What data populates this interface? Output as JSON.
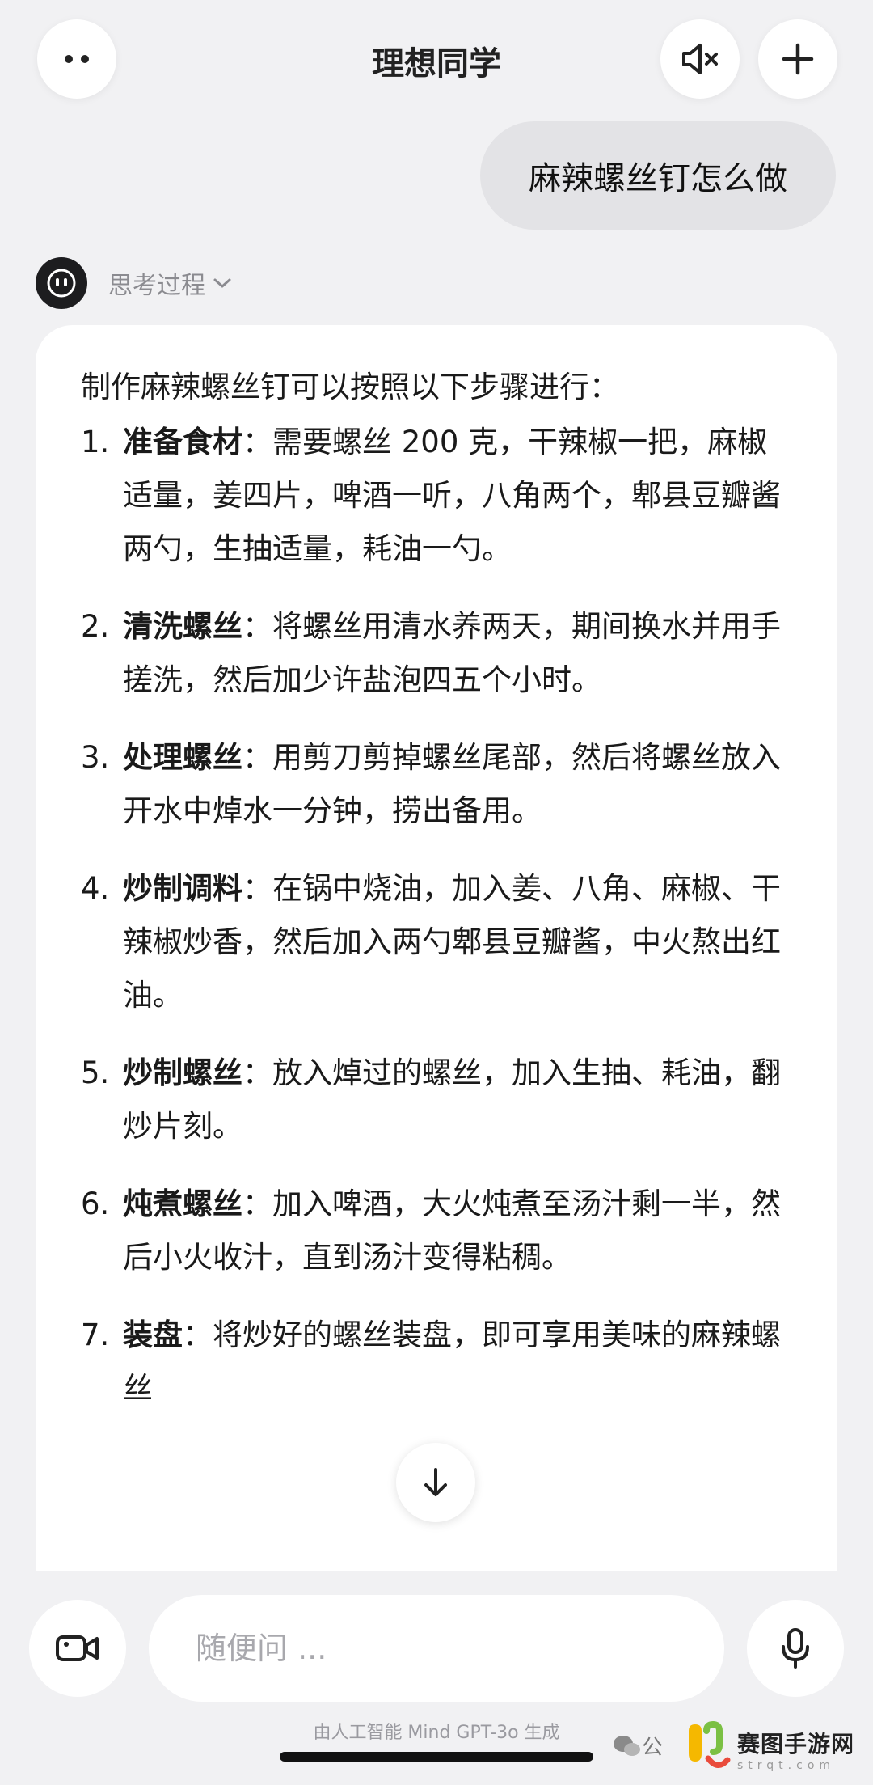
{
  "header": {
    "title": "理想同学"
  },
  "user_message": "麻辣螺丝钉怎么做",
  "assistant": {
    "thinking_label": "思考过程",
    "intro": "制作麻辣螺丝钉可以按照以下步骤进行：",
    "steps": [
      {
        "num": "1.",
        "title": "准备食材",
        "text": "：需要螺丝 200 克，干辣椒一把，麻椒适量，姜四片，啤酒一听，八角两个，郫县豆瓣酱两勺，生抽适量，耗油一勺。"
      },
      {
        "num": "2.",
        "title": "清洗螺丝",
        "text": "：将螺丝用清水养两天，期间换水并用手搓洗，然后加少许盐泡四五个小时。"
      },
      {
        "num": "3.",
        "title": "处理螺丝",
        "text": "：用剪刀剪掉螺丝尾部，然后将螺丝放入开水中焯水一分钟，捞出备用。"
      },
      {
        "num": "4.",
        "title": "炒制调料",
        "text": "：在锅中烧油，加入姜、八角、麻椒、干辣椒炒香，然后加入两勺郫县豆瓣酱，中火熬出红油。"
      },
      {
        "num": "5.",
        "title": "炒制螺丝",
        "text": "：放入焯过的螺丝，加入生抽、耗油，翻炒片刻。"
      },
      {
        "num": "6.",
        "title": "炖煮螺丝",
        "text": "：加入啤酒，大火炖煮至汤汁剩一半，然后小火收汁，直到汤汁变得粘稠。"
      },
      {
        "num": "7.",
        "title": "装盘",
        "text": "：将炒好的螺丝装盘，即可享用美味的麻辣螺丝"
      }
    ]
  },
  "input": {
    "placeholder": "随便问 ..."
  },
  "footer_note": "由人工智能 Mind GPT-3o 生成",
  "watermark": {
    "left_text": "公",
    "main": "赛图手游网",
    "sub": "strqt.com"
  }
}
